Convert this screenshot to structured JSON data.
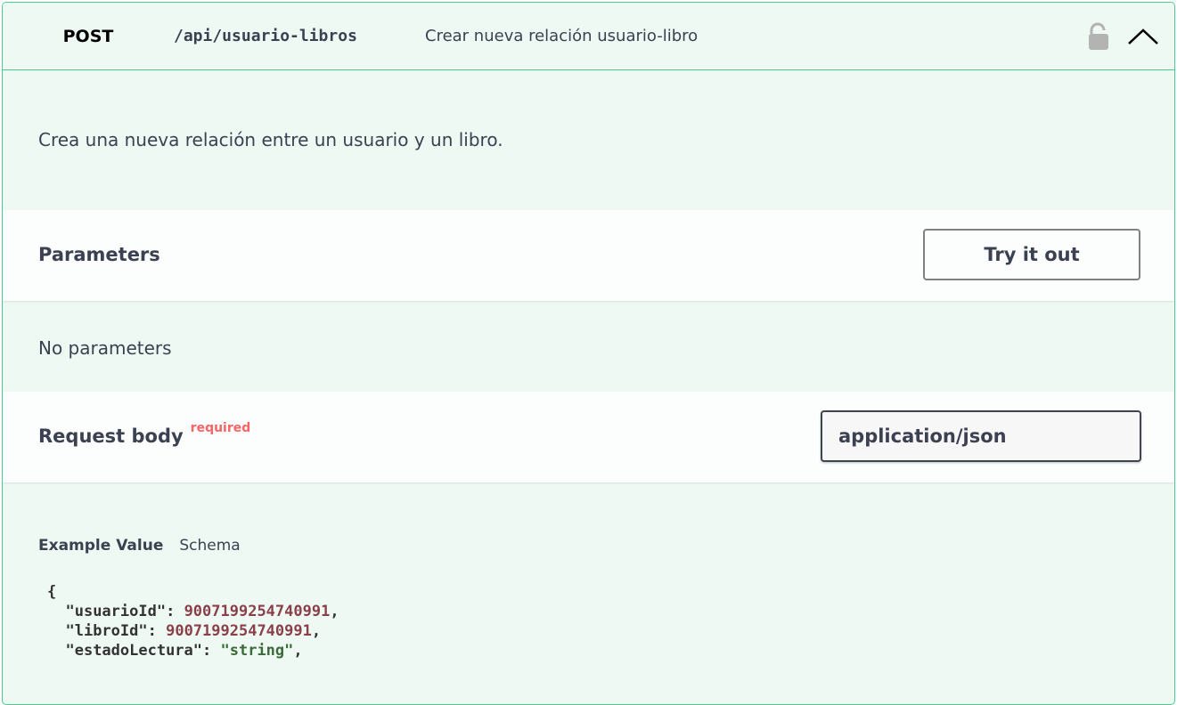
{
  "operation": {
    "method": "POST",
    "path": "/api/usuario-libros",
    "summary": "Crear nueva relación usuario-libro",
    "description": "Crea una nueva relación entre un usuario y un libro.",
    "icons": {
      "lock": "lock-icon",
      "collapse": "chevron-up-icon"
    }
  },
  "parameters": {
    "title": "Parameters",
    "try_button": "Try it out",
    "empty_text": "No parameters"
  },
  "request_body": {
    "title": "Request body",
    "required_label": "required",
    "content_type": "application/json",
    "tabs": [
      "Example Value",
      "Schema"
    ],
    "example": {
      "open_brace": "{",
      "fields": [
        {
          "key": "\"usuarioId\"",
          "value": "9007199254740991",
          "kind": "number",
          "trail": ","
        },
        {
          "key": "\"libroId\"",
          "value": "9007199254740991",
          "kind": "number",
          "trail": ","
        },
        {
          "key": "\"estadoLectura\"",
          "value": "\"string\"",
          "kind": "string",
          "trail": ","
        }
      ]
    }
  },
  "colors": {
    "accent": "#49cc90",
    "background": "#eef9f4",
    "required": "#f93e3e",
    "number": "#8b4049",
    "string": "#3a6b38"
  }
}
